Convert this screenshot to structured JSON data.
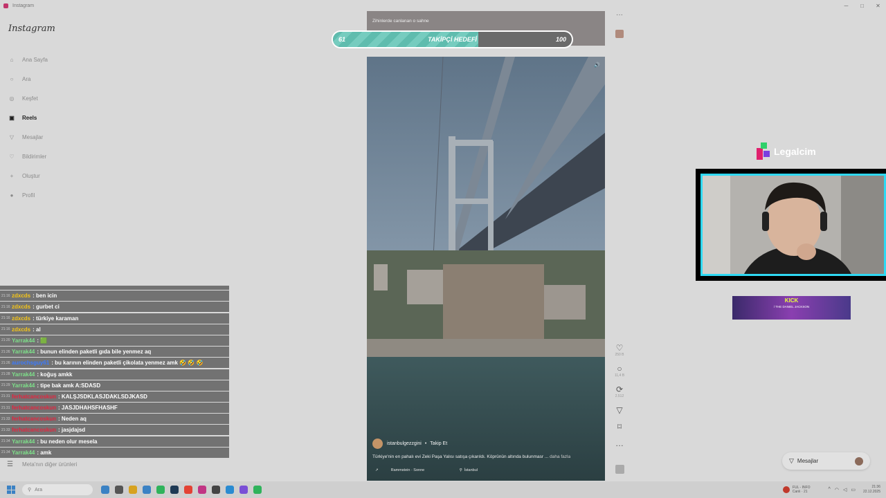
{
  "window": {
    "title": "Instagram",
    "controls": [
      "─",
      "□",
      "✕"
    ]
  },
  "sidebar": {
    "brand": "Instagram",
    "items": [
      {
        "label": "Ana Sayfa",
        "icon": "home-icon",
        "glyph": "⌂"
      },
      {
        "label": "Ara",
        "icon": "search-icon",
        "glyph": "○"
      },
      {
        "label": "Keşfet",
        "icon": "compass-icon",
        "glyph": "◎"
      },
      {
        "label": "Reels",
        "icon": "reels-icon",
        "glyph": "▣"
      },
      {
        "label": "Mesajlar",
        "icon": "send-icon",
        "glyph": "▽"
      },
      {
        "label": "Bildirimler",
        "icon": "heart-icon",
        "glyph": "♡"
      },
      {
        "label": "Oluştur",
        "icon": "plus-icon",
        "glyph": "+"
      },
      {
        "label": "Profil",
        "icon": "avatar-icon",
        "glyph": "●"
      }
    ],
    "meta_link": "Meta'nın diğer ürünleri",
    "meta_icon": "menu-icon"
  },
  "chat": {
    "messages": [
      {
        "time": "21:16",
        "user": "zdxcds",
        "color": "#f5c518",
        "text": ": ben icin"
      },
      {
        "time": "21:16",
        "user": "zdxcds",
        "color": "#f5c518",
        "text": ": gurbet ci"
      },
      {
        "time": "21:16",
        "user": "zdxcds",
        "color": "#f5c518",
        "text": ": türkiye karaman"
      },
      {
        "time": "21:16",
        "user": "zdxcds",
        "color": "#f5c518",
        "text": ": al"
      },
      {
        "time": "21:20",
        "user": "Yarrak44",
        "color": "#7ee08a",
        "text": ": 🟩"
      },
      {
        "time": "21:26",
        "user": "Yarrak44",
        "color": "#7ee08a",
        "text": ": bunun elinden paketli gıda bile yenmez aq"
      },
      {
        "time": "21:26",
        "user": "aurochsguy61",
        "color": "#3b7bff",
        "text": ": bu karının elinden paketli çikolata yenmez amk 🤣 🤣 🤣"
      },
      {
        "time": "21:28",
        "user": "Yarrak44",
        "color": "#7ee08a",
        "text": ": koğuş amkk"
      },
      {
        "time": "21:29",
        "user": "Yarrak44",
        "color": "#7ee08a",
        "text": ": tipe bak amk A:SDASD"
      },
      {
        "time": "21:31",
        "user": "ferhatcancoskun",
        "color": "#e5243f",
        "text": ": KALŞJSDKLASJDAKLSDJKASD"
      },
      {
        "time": "21:31",
        "user": "ferhatcancoskun",
        "color": "#e5243f",
        "text": ": JASJDHAHSFHASHF"
      },
      {
        "time": "21:33",
        "user": "ferhatcancoskun",
        "color": "#e5243f",
        "text": ": Neden aq"
      },
      {
        "time": "21:33",
        "user": "ferhatcancoskun",
        "color": "#e5243f",
        "text": ": jasjdajsd"
      },
      {
        "time": "21:34",
        "user": "Yarrak44",
        "color": "#7ee08a",
        "text": ": bu neden olur mesela"
      },
      {
        "time": "21:34",
        "user": "Yarrak44",
        "color": "#7ee08a",
        "text": ": amk"
      }
    ]
  },
  "reel_top": {
    "caption": "Zihinlerde canlanan o sahne"
  },
  "goal": {
    "label": "TAKİPÇİ HEDEFİ",
    "current": "61",
    "max": "100",
    "current_value": 61,
    "max_value": 100
  },
  "reel": {
    "username": "istanbulgezzgini",
    "follow": "Takip Et",
    "caption": "Türkiye'nin en pahalı evi Zeki Paşa Yalısı satışa çıkarıldı. Köprünün altında bulunmasr ...",
    "more": "daha fazla",
    "audio": "Rammstein · Sonne",
    "location": "İstanbul",
    "mute_icon": "speaker-icon"
  },
  "actions": [
    {
      "icon": "heart-icon",
      "glyph": "♡",
      "count": "250 B"
    },
    {
      "icon": "comment-icon",
      "glyph": "○",
      "count": "11,4 B"
    },
    {
      "icon": "repost-icon",
      "glyph": "⟳",
      "count": "2.512"
    },
    {
      "icon": "share-icon",
      "glyph": "▽",
      "count": ""
    },
    {
      "icon": "bookmark-icon",
      "glyph": "⌑",
      "count": ""
    },
    {
      "icon": "more-icon",
      "glyph": "…",
      "count": ""
    }
  ],
  "overlay": {
    "legal_logo": "Legalcim",
    "banner_title": "KICK",
    "banner_sub": "/ THE DANIEL JACKSON"
  },
  "messages_button": {
    "label": "Mesajlar",
    "icon": "send-icon"
  },
  "taskbar": {
    "search_placeholder": "Ara",
    "weather_title": "FUL - INFO",
    "weather_sub": "Canlı · 21",
    "time": "21:36",
    "date": "22.12.2025",
    "apps": [
      "#3b82c4",
      "#555",
      "#d7a220",
      "#3b82c4",
      "#2fb35b",
      "#1f3a55",
      "#e34234",
      "#c13584",
      "#444",
      "#2a8bd1",
      "#7a4fd6",
      "#2fb35b"
    ]
  },
  "colors": {
    "accent_cyan": "#2fd9f3",
    "goal_fill": "#6fc8ba"
  }
}
